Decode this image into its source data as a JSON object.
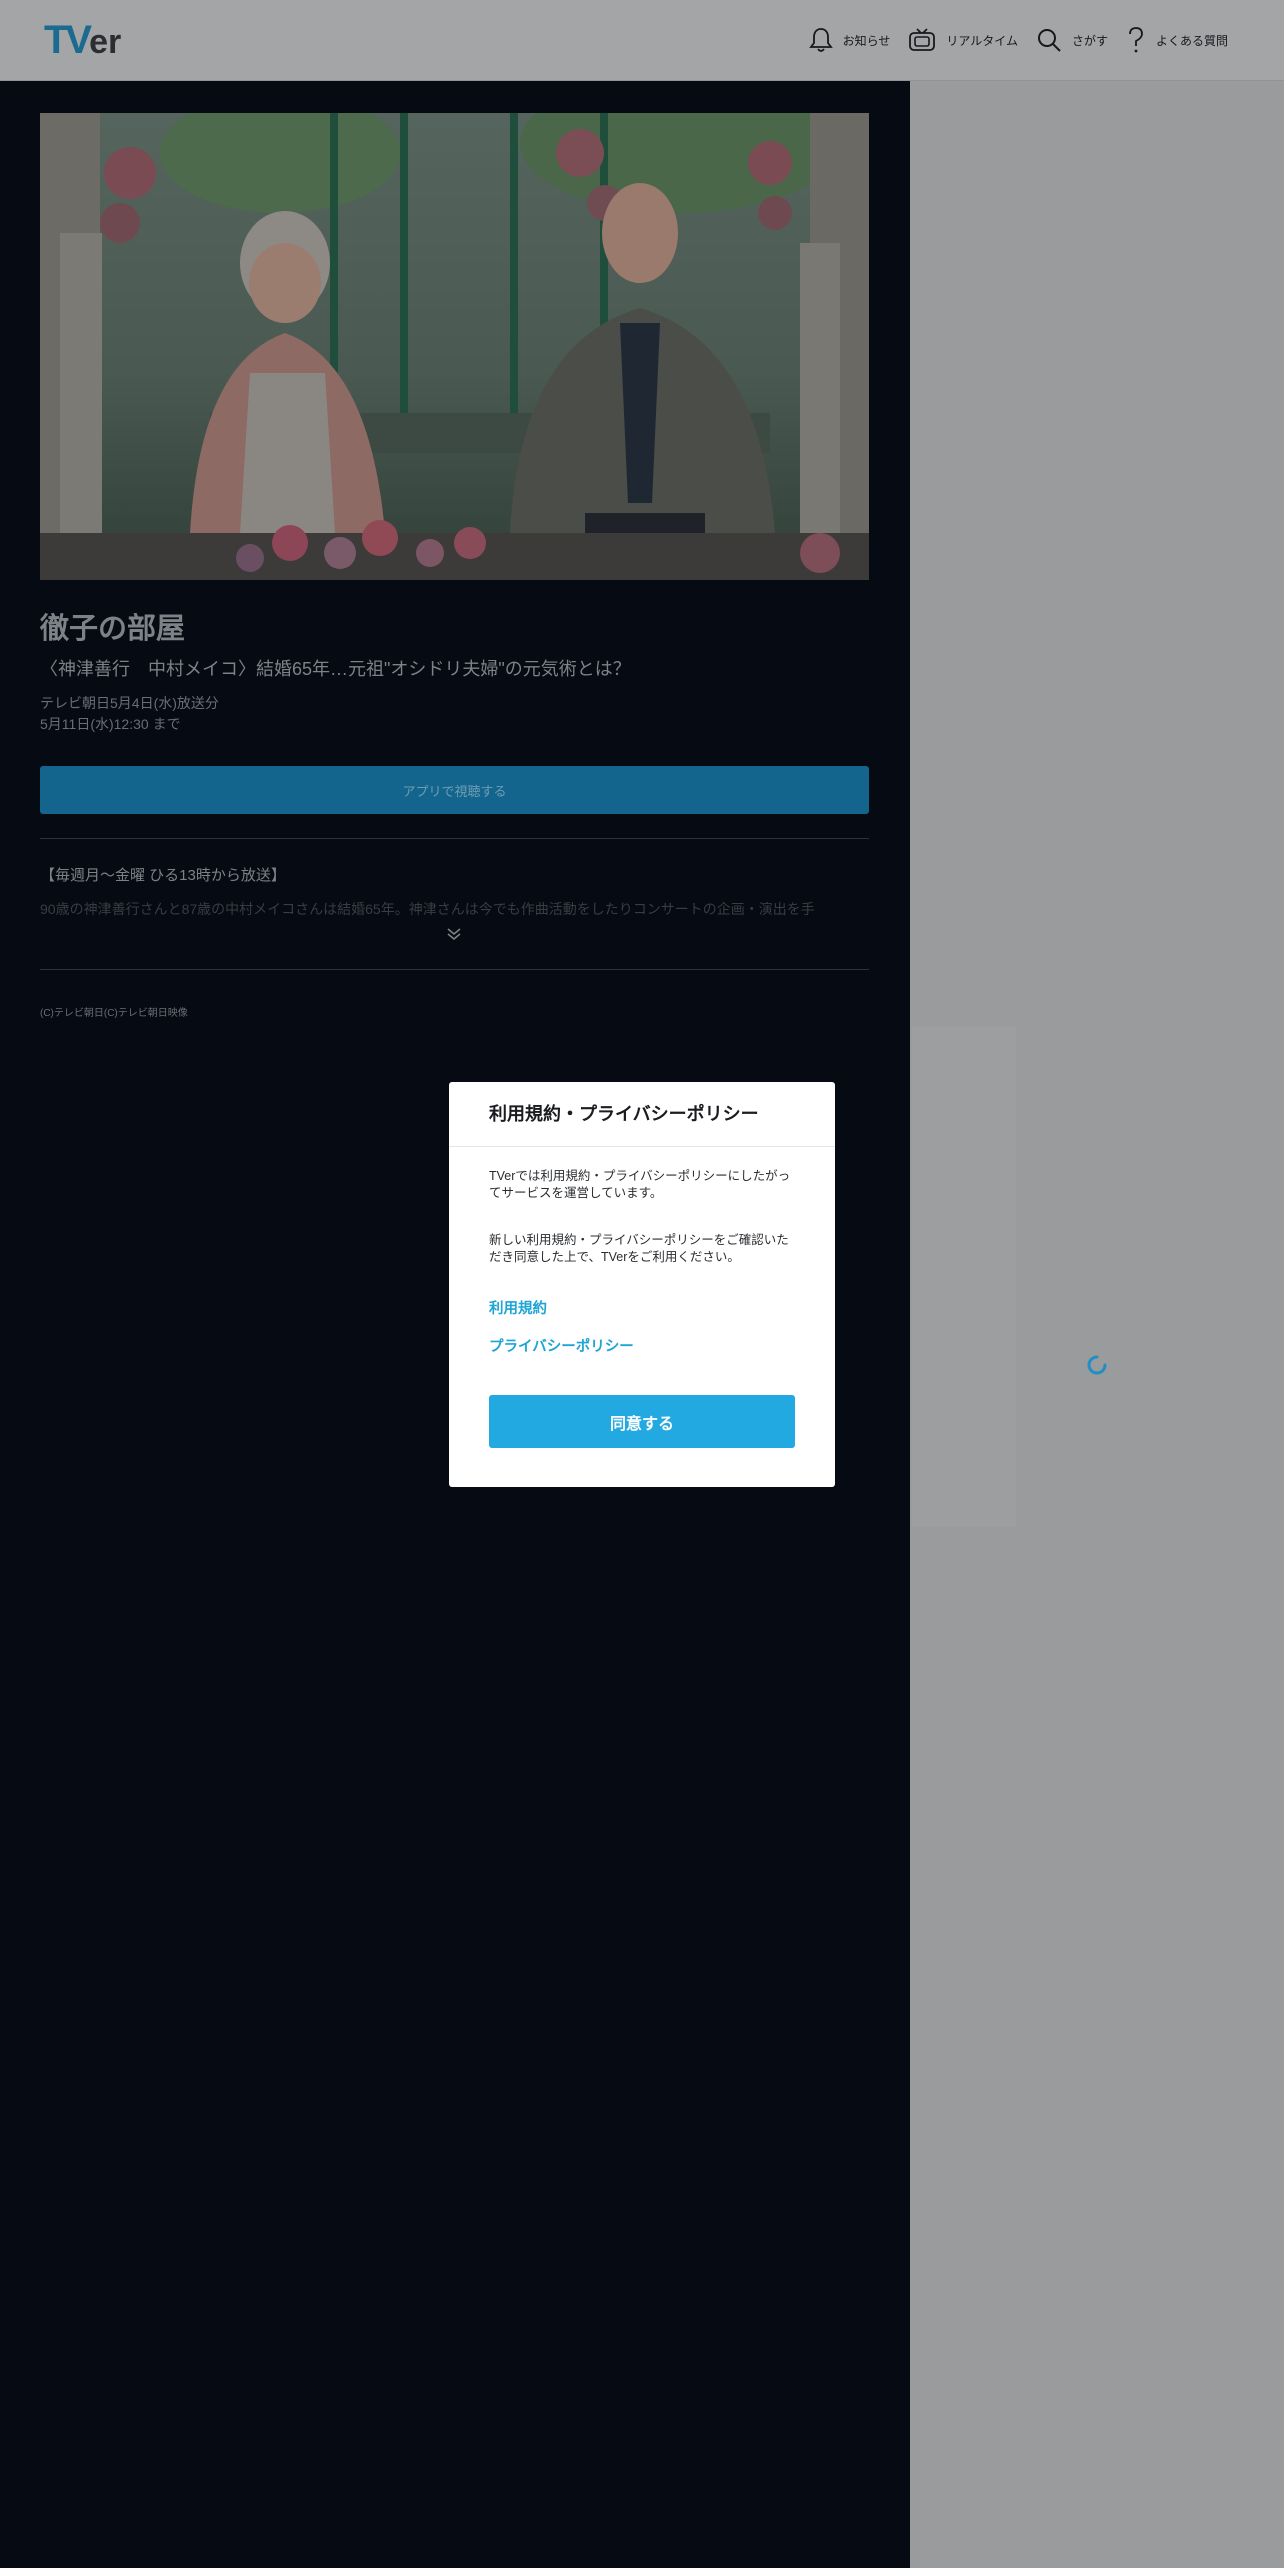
{
  "header": {
    "logo_tv": "TV",
    "logo_er": "er",
    "nav": [
      {
        "label": "お知らせ",
        "icon": "bell-icon"
      },
      {
        "label": "リアルタイム",
        "icon": "tv-icon"
      },
      {
        "label": "さがす",
        "icon": "search-icon"
      },
      {
        "label": "よくある質問",
        "icon": "question-icon"
      }
    ]
  },
  "episode": {
    "series_title": "徹子の部屋",
    "episode_title": "〈神津善行　中村メイコ〉結婚65年…元祖\"オシドリ夫婦\"の元気術とは？",
    "broadcast": "テレビ朝日5月4日(水)放送分",
    "available_until": "5月11日(水)12:30 まで",
    "app_button": "アプリで視聴する",
    "description_head": "【毎週月～金曜 ひる13時から放送】",
    "description_body": "90歳の神津善行さんと87歳の中村メイコさんは結婚65年。神津さんは今でも作曲活動をしたりコンサートの企画・演出を手",
    "copyright": "(C)テレビ朝日(C)テレビ朝日映像"
  },
  "modal": {
    "title": "利用規約・プライバシーポリシー",
    "paragraph1": "TVerでは利用規約・プライバシーポリシーにしたがってサービスを運営しています。",
    "paragraph2": "新しい利用規約・プライバシーポリシーをご確認いただき同意した上で、TVerをご利用ください。",
    "link_terms": "利用規約",
    "link_privacy": "プライバシーポリシー",
    "agree_button": "同意する"
  },
  "colors": {
    "accent": "#23a9e2",
    "link": "#1fa4d6",
    "content_bg": "#050a13",
    "overlay_gray": "#9a9b9d"
  }
}
